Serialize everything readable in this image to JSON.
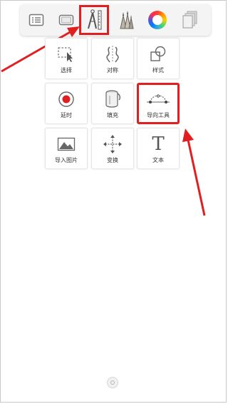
{
  "toolbar": {
    "items": [
      {
        "name": "list-icon"
      },
      {
        "name": "canvas-icon"
      },
      {
        "name": "compass-ruler-icon",
        "active": true
      },
      {
        "name": "pencils-icon"
      },
      {
        "name": "color-wheel-icon"
      },
      {
        "name": "layers-icon"
      }
    ]
  },
  "tools": {
    "select": "选择",
    "symmetry": "对称",
    "style": "样式",
    "timelapse": "延时",
    "fill": "填充",
    "guide": "导向工具",
    "import_image": "导入图片",
    "transform": "变换",
    "text": "文本",
    "text_glyph": "T"
  },
  "colors": {
    "highlight": "#e02020",
    "record_dot": "#e02020"
  }
}
